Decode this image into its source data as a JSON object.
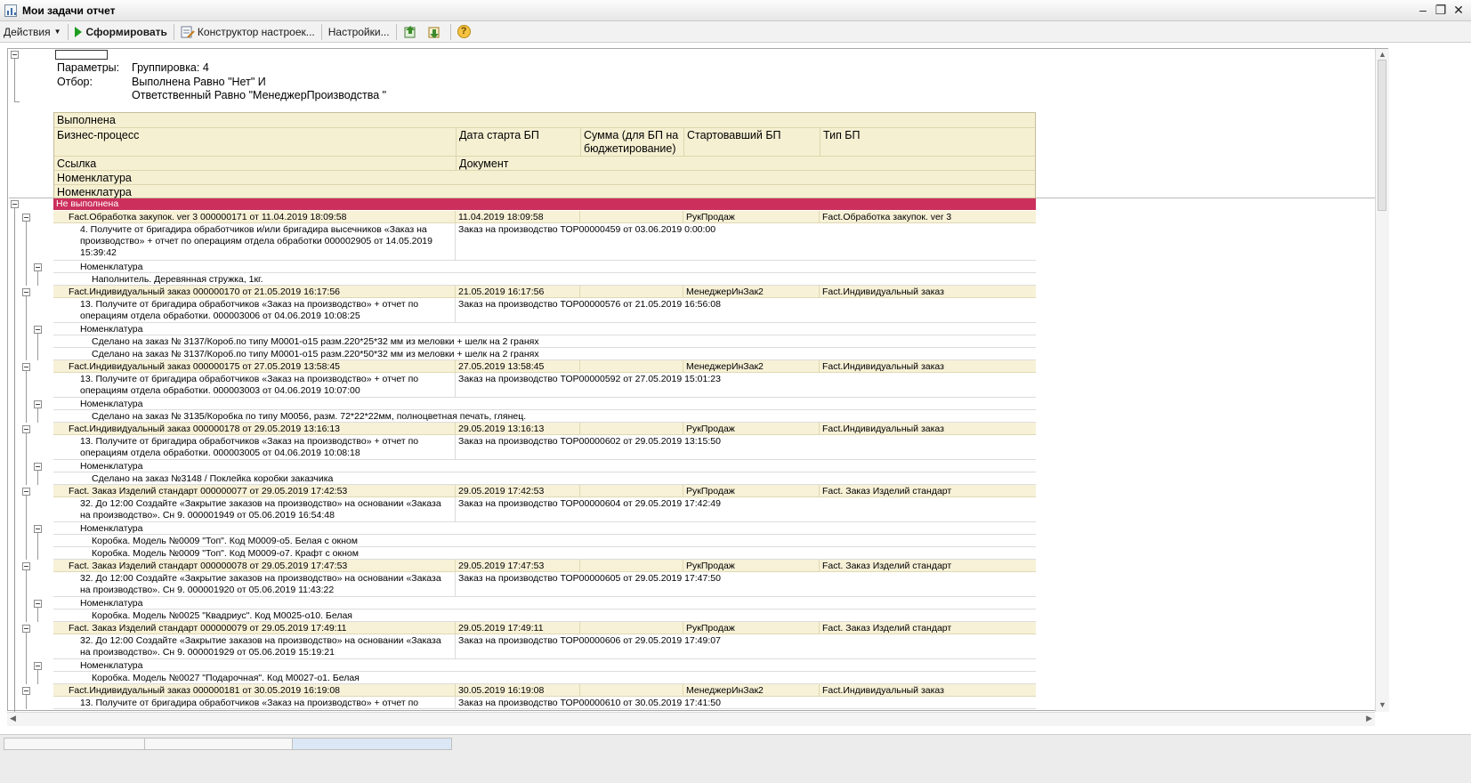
{
  "window": {
    "title": "Мои задачи отчет"
  },
  "toolbar": {
    "actions": "Действия",
    "generate": "Сформировать",
    "constructor": "Конструктор настроек...",
    "settings": "Настройки..."
  },
  "params": {
    "label_params": "Параметры:",
    "grouping": "Группировка: 4",
    "label_filter": "Отбор:",
    "filter_line1": "Выполнена Равно \"Нет\" И",
    "filter_line2": "Ответственный Равно \"МенеджерПроизводства \""
  },
  "header": {
    "done": "Выполнена",
    "process": "Бизнес-процесс",
    "start_date": "Дата старта БП",
    "sum_line1": "Сумма (для БП на",
    "sum_line2": "бюджетирование)",
    "started_by": "Стартовавший БП",
    "type": "Тип БП",
    "link": "Ссылка",
    "document": "Документ",
    "nom1": "Номенклатура",
    "nom2": "Номенклатура"
  },
  "group_label": "Не выполнена",
  "nom_label": "Номенклатура",
  "records": [
    {
      "process": "Fact.Обработка закупок. ver 3 000000171 от 11.04.2019 18:09:58",
      "date": "11.04.2019 18:09:58",
      "user": "РукПродаж",
      "type": "Fact.Обработка закупок. ver 3",
      "task": "4. Получите от бригадира обработчиков и/или бригадира высечников «Заказ на производство» + отчет по операциям отдела обработки 000002905 от 14.05.2019 15:39:42",
      "doc": "Заказ на производство ТОР00000459 от 03.06.2019 0:00:00",
      "items": [
        "Наполнитель. Деревянная стружка, 1кг."
      ]
    },
    {
      "process": "Fact.Индивидуальный заказ 000000170 от 21.05.2019 16:17:56",
      "date": "21.05.2019 16:17:56",
      "user": "МенеджерИнЗак2",
      "type": "Fact.Индивидуальный заказ",
      "task": "13. Получите от бригадира обработчиков «Заказ на производство» + отчет по операциям отдела обработки. 000003006 от 04.06.2019 10:08:25",
      "doc": "Заказ на производство ТОР00000576 от 21.05.2019 16:56:08",
      "items": [
        "Сделано на заказ № 3137/Короб.по типу М0001-о15  разм.220*25*32 мм из меловки + шелк на 2 гранях",
        "Сделано на заказ № 3137/Короб.по типу М0001-о15  разм.220*50*32 мм из меловки + шелк на 2 гранях"
      ]
    },
    {
      "process": "Fact.Индивидуальный заказ 000000175 от 27.05.2019 13:58:45",
      "date": "27.05.2019 13:58:45",
      "user": "МенеджерИнЗак2",
      "type": "Fact.Индивидуальный заказ",
      "task": "13. Получите от бригадира обработчиков «Заказ на производство» + отчет по операциям отдела обработки. 000003003 от 04.06.2019 10:07:00",
      "doc": "Заказ на производство ТОР00000592 от 27.05.2019 15:01:23",
      "items": [
        "Сделано на заказ № 3135/Коробка по типу М0056, разм. 72*22*22мм, полноцветная печать, глянец."
      ]
    },
    {
      "process": "Fact.Индивидуальный заказ 000000178 от 29.05.2019 13:16:13",
      "date": "29.05.2019 13:16:13",
      "user": "РукПродаж",
      "type": "Fact.Индивидуальный заказ",
      "task": "13. Получите от бригадира обработчиков «Заказ на производство» + отчет по операциям отдела обработки. 000003005 от 04.06.2019 10:08:18",
      "doc": "Заказ на производство ТОР00000602 от 29.05.2019 13:15:50",
      "items": [
        "Сделано на заказ №3148 / Поклейка коробки заказчика"
      ]
    },
    {
      "process": "Fact. Заказ Изделий стандарт 000000077 от 29.05.2019 17:42:53",
      "date": "29.05.2019 17:42:53",
      "user": "РукПродаж",
      "type": "Fact. Заказ Изделий стандарт",
      "task": "32. До 12:00 Создайте «Закрытие заказов на производство» на основании «Заказа на производство». Сн 9. 000001949 от 05.06.2019 16:54:48",
      "doc": "Заказ на производство ТОР00000604 от 29.05.2019 17:42:49",
      "items": [
        "Коробка. Модель №0009 \"Топ\". Код М0009-о5. Белая с окном",
        "Коробка. Модель №0009 \"Топ\". Код М0009-о7. Крафт с окном"
      ]
    },
    {
      "process": "Fact. Заказ Изделий стандарт 000000078 от 29.05.2019 17:47:53",
      "date": "29.05.2019 17:47:53",
      "user": "РукПродаж",
      "type": "Fact. Заказ Изделий стандарт",
      "task": "32. До 12:00 Создайте «Закрытие заказов на производство» на основании «Заказа на производство». Сн 9. 000001920 от 05.06.2019 11:43:22",
      "doc": "Заказ на производство ТОР00000605 от 29.05.2019 17:47:50",
      "items": [
        "Коробка. Модель №0025 \"Квадриус\". Код М0025-о10. Белая"
      ]
    },
    {
      "process": "Fact. Заказ Изделий стандарт 000000079 от 29.05.2019 17:49:11",
      "date": "29.05.2019 17:49:11",
      "user": "РукПродаж",
      "type": "Fact. Заказ Изделий стандарт",
      "task": "32. До 12:00 Создайте «Закрытие заказов на производство» на основании «Заказа на производство». Сн 9. 000001929 от 05.06.2019 15:19:21",
      "doc": "Заказ на производство ТОР00000606 от 29.05.2019 17:49:07",
      "items": [
        "Коробка. Модель №0027 \"Подарочная\". Код М0027-о1. Белая"
      ]
    },
    {
      "process": "Fact.Индивидуальный заказ 000000181 от 30.05.2019 16:19:08",
      "date": "30.05.2019 16:19:08",
      "user": "МенеджерИнЗак2",
      "type": "Fact.Индивидуальный заказ",
      "task": "13. Получите от бригадира обработчиков «Заказ на производство» + отчет по",
      "doc": "Заказ на производство ТОР00000610 от 30.05.2019 17:41:50",
      "items": []
    }
  ]
}
